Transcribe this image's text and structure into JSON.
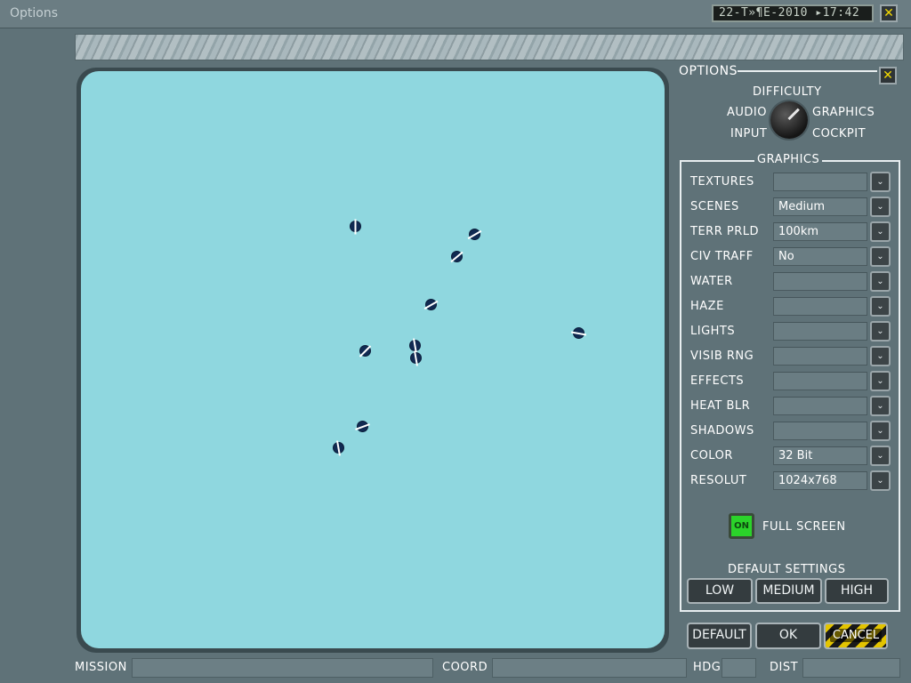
{
  "window": {
    "title": "Options",
    "datetime": "22-T»¶E-2010 ▸17:42",
    "close_glyph": "✕"
  },
  "map": {
    "markers": [
      {
        "name": "marker-1"
      },
      {
        "name": "marker-2"
      },
      {
        "name": "marker-3"
      },
      {
        "name": "marker-4"
      },
      {
        "name": "marker-5"
      },
      {
        "name": "marker-6"
      },
      {
        "name": "marker-7"
      },
      {
        "name": "marker-8"
      },
      {
        "name": "marker-9"
      },
      {
        "name": "marker-10"
      },
      {
        "name": "marker-11"
      }
    ]
  },
  "options": {
    "title": "OPTIONS",
    "close_glyph": "✕",
    "selector": {
      "top": "DIFFICULTY",
      "left_top": "AUDIO",
      "left_bottom": "INPUT",
      "right_top": "GRAPHICS",
      "right_bottom": "COCKPIT"
    }
  },
  "graphics": {
    "title": "GRAPHICS",
    "rows": [
      {
        "label": "TEXTURES",
        "value": ""
      },
      {
        "label": "SCENES",
        "value": "Medium"
      },
      {
        "label": "TERR PRLD",
        "value": "100km"
      },
      {
        "label": "CIV TRAFF",
        "value": "No"
      },
      {
        "label": "WATER",
        "value": ""
      },
      {
        "label": "HAZE",
        "value": ""
      },
      {
        "label": "LIGHTS",
        "value": ""
      },
      {
        "label": "VISIB RNG",
        "value": ""
      },
      {
        "label": "EFFECTS",
        "value": ""
      },
      {
        "label": "HEAT BLR",
        "value": ""
      },
      {
        "label": "SHADOWS",
        "value": ""
      },
      {
        "label": "COLOR",
        "value": "32 Bit"
      },
      {
        "label": "RESOLUT",
        "value": "1024x768"
      }
    ],
    "dropdown_glyph": "⌄",
    "fullscreen": {
      "toggle": "ON",
      "label": "FULL SCREEN",
      "color": "#2bd32a"
    },
    "defaults": {
      "title": "DEFAULT SETTINGS",
      "low": "LOW",
      "medium": "MEDIUM",
      "high": "HIGH"
    }
  },
  "actions": {
    "default": "DEFAULT",
    "ok": "OK",
    "cancel": "CANCEL"
  },
  "status": {
    "mission": "MISSION",
    "coord": "COORD",
    "hdg": "HDG",
    "dist": "DIST"
  }
}
